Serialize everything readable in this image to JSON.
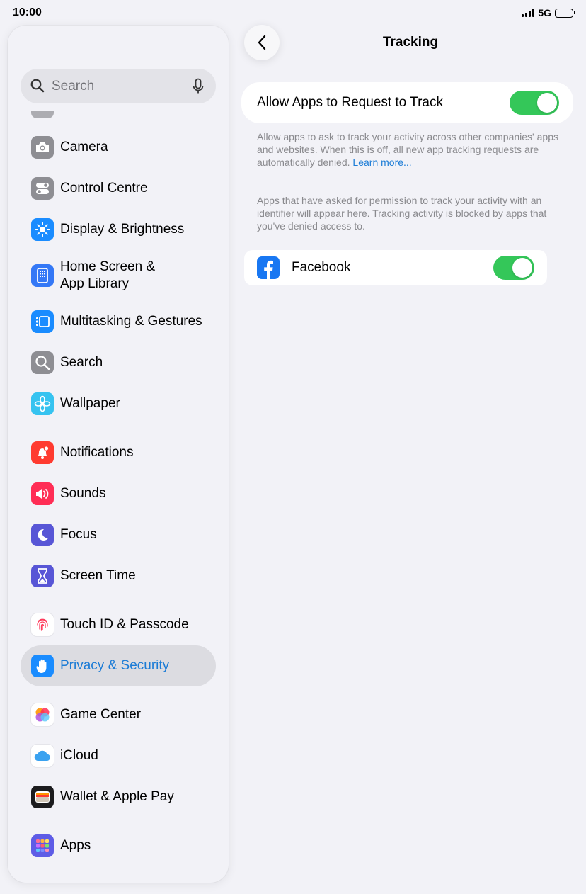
{
  "status": {
    "time": "10:00",
    "network": "5G"
  },
  "sidebar": {
    "search_placeholder": "Search",
    "items": [
      {
        "label": "Camera",
        "icon": "camera-icon",
        "color": "#8e8e93"
      },
      {
        "label": "Control Centre",
        "icon": "switches-icon",
        "color": "#8e8e93"
      },
      {
        "label": "Display & Brightness",
        "icon": "sun-icon",
        "color": "#1a8cff"
      },
      {
        "label": "Home Screen &",
        "label2": "App Library",
        "icon": "home-grid-icon",
        "color": "#3478f6"
      },
      {
        "label": "Multitasking & Gestures",
        "icon": "multitasking-icon",
        "color": "#1a8cff"
      },
      {
        "label": "Search",
        "icon": "magnifier-icon",
        "color": "#8e8e93"
      },
      {
        "label": "Wallpaper",
        "icon": "flower-icon",
        "color": "#36c3f0"
      },
      {
        "label": "Notifications",
        "icon": "bell-icon",
        "color": "#ff3b30"
      },
      {
        "label": "Sounds",
        "icon": "speaker-icon",
        "color": "#ff2d55"
      },
      {
        "label": "Focus",
        "icon": "moon-icon",
        "color": "#5856d6"
      },
      {
        "label": "Screen Time",
        "icon": "hourglass-icon",
        "color": "#5856d6"
      },
      {
        "label": "Touch ID & Passcode",
        "icon": "fingerprint-icon",
        "color": "#ffffff"
      },
      {
        "label": "Privacy & Security",
        "icon": "hand-icon",
        "color": "#1a8cff",
        "selected": true
      },
      {
        "label": "Game Center",
        "icon": "game-center-icon",
        "color": "#ffffff"
      },
      {
        "label": "iCloud",
        "icon": "cloud-icon",
        "color": "#ffffff"
      },
      {
        "label": "Wallet & Apple Pay",
        "icon": "wallet-icon",
        "color": "#1c1c1e"
      },
      {
        "label": "Apps",
        "icon": "apps-grid-icon",
        "color": "#5e5ce6"
      }
    ]
  },
  "detail": {
    "title": "Tracking",
    "allow_label": "Allow Apps to Request to Track",
    "allow_on": true,
    "allow_note": "Allow apps to ask to track your activity across other companies' apps and websites. When this is off, all new app tracking requests are automatically denied.",
    "learn_more": "Learn more...",
    "apps_note": "Apps that have asked for permission to track your activity with an identifier will appear here. Tracking activity is blocked by apps that you've denied access to.",
    "apps": [
      {
        "label": "Facebook",
        "icon": "facebook-icon",
        "on": true
      }
    ]
  }
}
